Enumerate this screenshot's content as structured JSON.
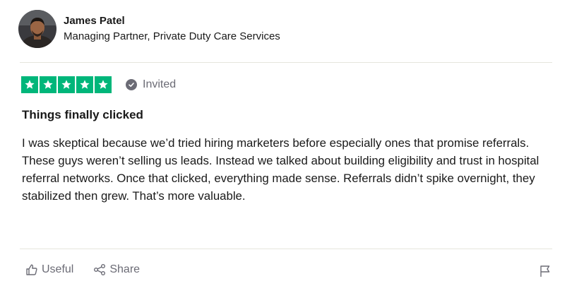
{
  "reviewer": {
    "name": "James Patel",
    "title": "Managing Partner, Private Duty Care Services",
    "avatar_icon": "person-photo"
  },
  "rating": {
    "stars": 5,
    "max_stars": 5,
    "star_color": "#00b67a",
    "badge_label": "Invited",
    "badge_icon": "check-circle-icon"
  },
  "review": {
    "title": "Things finally clicked",
    "body": "I was skeptical because we’d tried hiring marketers before especially ones that promise referrals. These guys weren’t selling us leads. Instead we talked about building eligibility and trust in hospital referral networks. Once that clicked, everything made sense. Referrals didn’t spike overnight, they stabilized then grew. That’s more valuable."
  },
  "actions": {
    "useful_label": "Useful",
    "share_label": "Share",
    "useful_icon": "thumbs-up-icon",
    "share_icon": "share-icon",
    "flag_icon": "flag-icon"
  },
  "colors": {
    "muted_text": "#6b6b75",
    "divider": "#e5e5dd"
  }
}
